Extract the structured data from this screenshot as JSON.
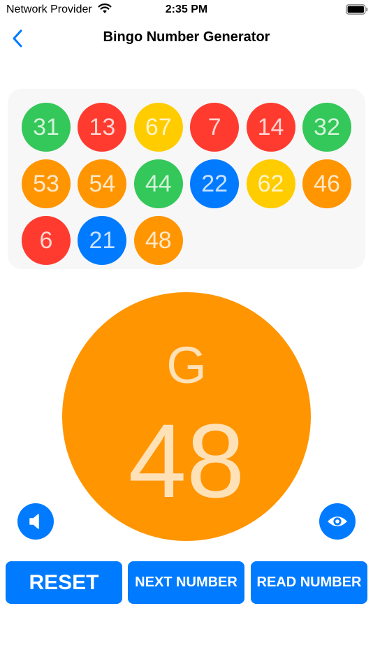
{
  "status_bar": {
    "carrier": "Network Provider",
    "time": "2:35 PM"
  },
  "nav": {
    "title": "Bingo Number Generator",
    "back_icon": "chevron-left-icon"
  },
  "colors": {
    "green": "#34c759",
    "red": "#ff3b30",
    "yellow": "#ffcc00",
    "orange": "#ff9500",
    "blue": "#007aff"
  },
  "history": [
    {
      "number": "31",
      "color": "green"
    },
    {
      "number": "13",
      "color": "red"
    },
    {
      "number": "67",
      "color": "yellow"
    },
    {
      "number": "7",
      "color": "red"
    },
    {
      "number": "14",
      "color": "red"
    },
    {
      "number": "32",
      "color": "green"
    },
    {
      "number": "53",
      "color": "orange"
    },
    {
      "number": "54",
      "color": "orange"
    },
    {
      "number": "44",
      "color": "green"
    },
    {
      "number": "22",
      "color": "blue"
    },
    {
      "number": "62",
      "color": "yellow"
    },
    {
      "number": "46",
      "color": "orange"
    },
    {
      "number": "6",
      "color": "red"
    },
    {
      "number": "21",
      "color": "blue"
    },
    {
      "number": "48",
      "color": "orange"
    }
  ],
  "current": {
    "letter": "G",
    "number": "48",
    "color": "orange"
  },
  "controls": {
    "speaker_icon": "speaker-icon",
    "eye_icon": "eye-icon"
  },
  "buttons": {
    "reset": "RESET",
    "next": "NEXT NUMBER",
    "read": "READ NUMBER"
  }
}
